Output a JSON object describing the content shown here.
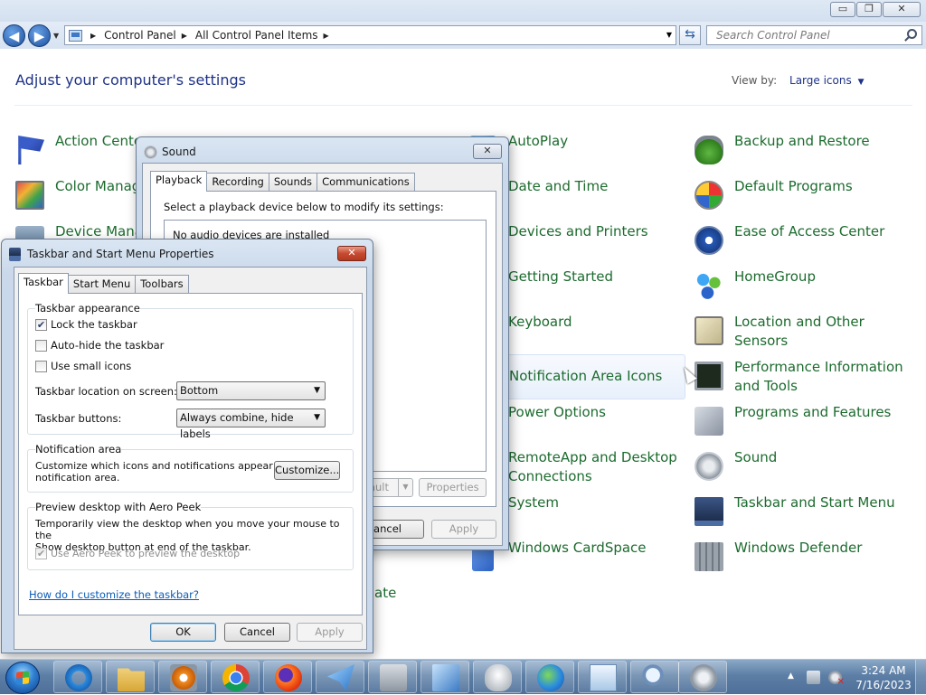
{
  "explorer": {
    "window_controls": {
      "minimize": "▭",
      "maximize": "❐",
      "close": "✕"
    },
    "nav": {
      "back": "◀",
      "forward": "▶"
    },
    "breadcrumbs": [
      "Control Panel",
      "All Control Panel Items"
    ],
    "search_placeholder": "Search Control Panel",
    "heading": "Adjust your computer's settings",
    "view_by_label": "View by:",
    "view_by_value": "Large icons"
  },
  "items": {
    "action_center": "Action Center",
    "color_management": "Color Management",
    "device_manager": "Device Manager",
    "autoplay": "AutoPlay",
    "date_time": "Date and Time",
    "devices_printers": "Devices and Printers",
    "getting_started": "Getting Started",
    "keyboard": "Keyboard",
    "notification_icons": "Notification Area Icons",
    "power_options": "Power Options",
    "remoteapp_1": "RemoteApp and Desktop",
    "remoteapp_2": "Connections",
    "system": "System",
    "cardspace": "Windows CardSpace",
    "windows_update_tail": "ate",
    "backup": "Backup and Restore",
    "default_programs": "Default Programs",
    "ease_access": "Ease of Access Center",
    "homegroup": "HomeGroup",
    "location_1": "Location and Other",
    "location_2": "Sensors",
    "performance_1": "Performance Information",
    "performance_2": "and Tools",
    "programs_features": "Programs and Features",
    "sound": "Sound",
    "taskbar_start": "Taskbar and Start Menu",
    "defender": "Windows Defender"
  },
  "sound_dialog": {
    "title": "Sound",
    "tabs": [
      "Playback",
      "Recording",
      "Sounds",
      "Communications"
    ],
    "instruction": "Select a playback device below to modify its settings:",
    "empty_message": "No audio devices are installed",
    "set_default_tail": "ault",
    "properties": "Properties",
    "cancel": "Cancel",
    "apply": "Apply"
  },
  "taskbar_dialog": {
    "title": "Taskbar and Start Menu Properties",
    "tabs": [
      "Taskbar",
      "Start Menu",
      "Toolbars"
    ],
    "appearance_group": "Taskbar appearance",
    "lock_taskbar": "Lock the taskbar",
    "lock_taskbar_checked": true,
    "auto_hide": "Auto-hide the taskbar",
    "small_icons": "Use small icons",
    "location_label": "Taskbar location on screen:",
    "location_value": "Bottom",
    "buttons_label": "Taskbar buttons:",
    "buttons_value": "Always combine, hide labels",
    "notification_group": "Notification area",
    "notification_desc_1": "Customize which icons and notifications appear in the",
    "notification_desc_2": "notification area.",
    "customize": "Customize...",
    "aero_group": "Preview desktop with Aero Peek",
    "aero_desc_1": "Temporarily view the desktop when you move your mouse to the",
    "aero_desc_2": "Show desktop button at end of the taskbar.",
    "aero_checkbox": "Use Aero Peek to preview the desktop",
    "help_link": "How do I customize the taskbar?",
    "ok": "OK",
    "cancel": "Cancel",
    "apply": "Apply",
    "check_mark": "✔"
  },
  "system_taskbar": {
    "tray_arrow": "▲",
    "time": "3:24 AM",
    "date": "7/16/2023"
  }
}
